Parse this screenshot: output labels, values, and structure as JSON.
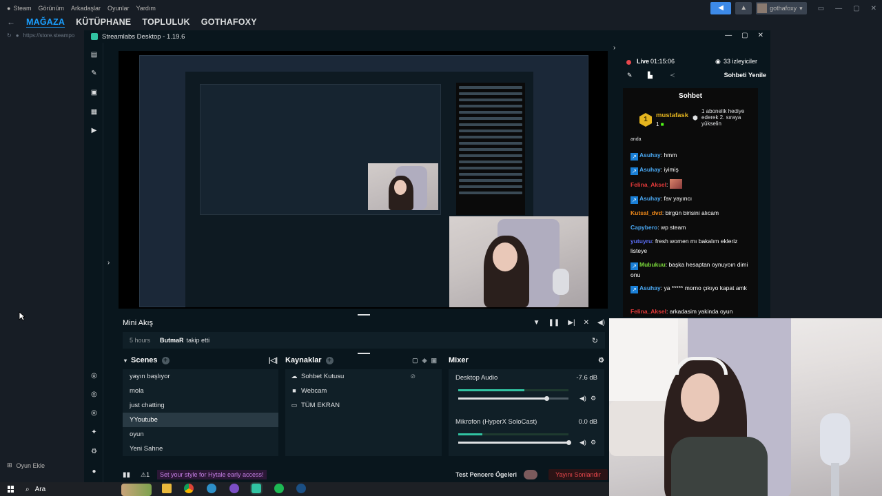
{
  "steam": {
    "menu": [
      "Steam",
      "Görünüm",
      "Arkadaşlar",
      "Oyunlar",
      "Yardım"
    ],
    "username": "gothafoxy",
    "nav_tabs": [
      "MAĞAZA",
      "KÜTÜPHANE",
      "TOPLULUK",
      "GOTHAFOXY"
    ],
    "active_tab": "MAĞAZA",
    "url": "https://store.steampo",
    "add_game": "Oyun Ekle"
  },
  "streamlabs": {
    "window_title": "Streamlabs Desktop - 1.19.6",
    "mini_feed": {
      "title": "Mini Akış",
      "time": "5 hours",
      "user": "ButmaR",
      "action": "takip etti"
    },
    "scenes": {
      "title": "Scenes",
      "items": [
        "yayın başlıyor",
        "mola",
        "just chatting",
        "YYoutube",
        "oyun",
        "Yeni Sahne"
      ],
      "selected": "YYoutube"
    },
    "sources": {
      "title": "Kaynaklar",
      "items": [
        {
          "label": "Sohbet Kutusu",
          "icon": "chat-icon"
        },
        {
          "label": "Webcam",
          "icon": "camera-icon"
        },
        {
          "label": "TÜM EKRAN",
          "icon": "monitor-icon"
        }
      ]
    },
    "mixer": {
      "title": "Mixer",
      "channels": [
        {
          "name": "Desktop Audio",
          "db": "-7.6 dB",
          "volume": 0.8
        },
        {
          "name": "Mikrofon (HyperX SoloCast)",
          "db": "0.0 dB",
          "volume": 1.0
        }
      ]
    },
    "footer": {
      "alert_count": "1",
      "promo": "Set your style for Hytale early access!",
      "test_label": "Test Pencere Ögeleri",
      "end_stream": "Yayını Sonlandır"
    }
  },
  "chat": {
    "live_label": "Live",
    "live_time": "01:15:06",
    "viewers": "33 izleyiciler",
    "refresh_label": "Sohbeti Yenile",
    "header": "Sohbet",
    "gift": {
      "badge": "1",
      "user": "mustafask",
      "count": "1",
      "message": "1 abonelik hediye ederek 2. sıraya yükselin"
    },
    "partial_top": "anda",
    "messages": [
      {
        "user": "Asuhay",
        "color": "#4aa8f2",
        "text": "hmm",
        "kick": true
      },
      {
        "user": "Asuhay",
        "color": "#4aa8f2",
        "text": "iyimiş",
        "kick": true
      },
      {
        "user": "Felina_Aksel",
        "color": "#e53a3a",
        "text": "",
        "emote": true
      },
      {
        "user": "Asuhay",
        "color": "#4aa8f2",
        "text": "fav yayıncı",
        "kick": true
      },
      {
        "user": "Kutsal_dvd",
        "color": "#f28b1a",
        "text": "birgün birisini alıcam"
      },
      {
        "user": "Capybero",
        "color": "#4aa8f2",
        "text": "wp steam"
      },
      {
        "user": "yutuyru",
        "color": "#5b6ef7",
        "text": "fresh women mı bakalım ekleriz listeye"
      },
      {
        "user": "Mubukuu",
        "color": "#7ad83a",
        "text": "başka hesaptan oynuyoın dimi onu",
        "kick": true
      },
      {
        "user": "Asuhay",
        "color": "#4aa8f2",
        "text": "ya ***** morno çıkıyo kapat amk",
        "kick": true
      },
      {
        "user": "Felina_Aksel",
        "color": "#e53a3a",
        "text": "arkadasim yakinda oyun"
      }
    ]
  },
  "taskbar": {
    "search": "Ara"
  }
}
